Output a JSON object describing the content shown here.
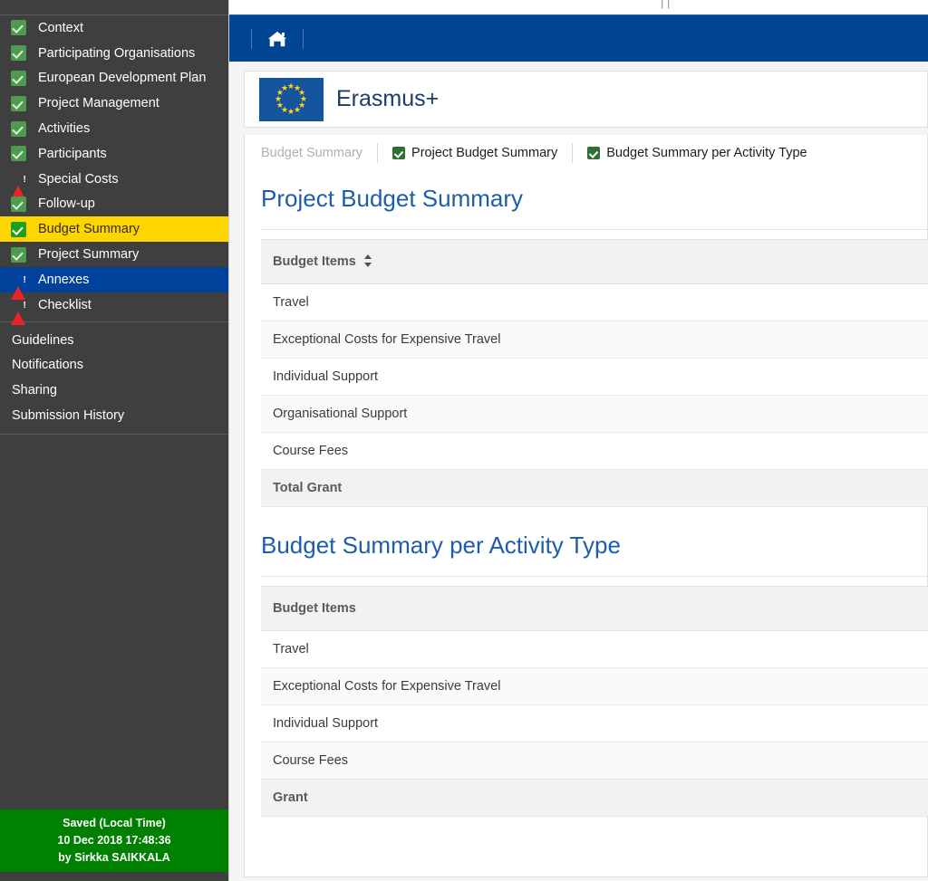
{
  "topstrip": {
    "ghost_left": "",
    "ghost_right": "| |"
  },
  "navbar": {
    "home_icon": "home-icon"
  },
  "logo": {
    "brand": "Erasmus+",
    "flag_alt": "european-union-flag"
  },
  "sidebar": {
    "items": [
      {
        "label": "Context",
        "status": "check",
        "state": "normal"
      },
      {
        "label": "Participating Organisations",
        "status": "check",
        "state": "normal"
      },
      {
        "label": "European Development Plan",
        "status": "check",
        "state": "normal"
      },
      {
        "label": "Project Management",
        "status": "check",
        "state": "normal"
      },
      {
        "label": "Activities",
        "status": "check",
        "state": "normal"
      },
      {
        "label": "Participants",
        "status": "check",
        "state": "normal"
      },
      {
        "label": "Special Costs",
        "status": "warn",
        "state": "normal"
      },
      {
        "label": "Follow-up",
        "status": "check",
        "state": "normal"
      },
      {
        "label": "Budget Summary",
        "status": "check",
        "state": "selected-yellow"
      },
      {
        "label": "Project Summary",
        "status": "check",
        "state": "normal"
      },
      {
        "label": "Annexes",
        "status": "warn",
        "state": "selected-blue"
      },
      {
        "label": "Checklist",
        "status": "warn",
        "state": "normal"
      }
    ],
    "links": [
      {
        "label": "Guidelines"
      },
      {
        "label": "Notifications"
      },
      {
        "label": "Sharing"
      },
      {
        "label": "Submission History"
      }
    ],
    "saved": {
      "line1": "Saved (Local Time)",
      "line2": "10 Dec 2018 17:48:36",
      "line3": "by Sirkka SAIKKALA"
    }
  },
  "breadcrumb": {
    "current": "Budget Summary",
    "crumbs": [
      {
        "label": "Project Budget Summary",
        "checked": true
      },
      {
        "label": "Budget Summary per Activity Type",
        "checked": true
      }
    ]
  },
  "sections": [
    {
      "title": "Project Budget Summary",
      "table": {
        "header": "Budget Items",
        "sortable": true,
        "rows": [
          {
            "label": "Travel",
            "kind": "row"
          },
          {
            "label": "Exceptional Costs for Expensive Travel",
            "kind": "row-alt"
          },
          {
            "label": "Individual Support",
            "kind": "row"
          },
          {
            "label": "Organisational Support",
            "kind": "row-alt"
          },
          {
            "label": "Course Fees",
            "kind": "row"
          },
          {
            "label": "Total Grant",
            "kind": "total"
          }
        ]
      }
    },
    {
      "title": "Budget Summary per Activity Type",
      "table": {
        "header": "Budget Items",
        "sortable": false,
        "rows": [
          {
            "label": "Travel",
            "kind": "row"
          },
          {
            "label": "Exceptional Costs for Expensive Travel",
            "kind": "row-alt"
          },
          {
            "label": "Individual Support",
            "kind": "row"
          },
          {
            "label": "Course Fees",
            "kind": "row-alt"
          },
          {
            "label": "Grant",
            "kind": "total"
          }
        ]
      }
    }
  ],
  "colors": {
    "navbar_blue": "#004494",
    "sidebar_dark": "#3f3f3f",
    "selected_yellow": "#ffd500",
    "selected_blue": "#00419b",
    "saved_green": "#008000",
    "heading_blue": "#1d5dab",
    "check_green": "#4e9a4e",
    "warn_red": "#e8232a"
  }
}
